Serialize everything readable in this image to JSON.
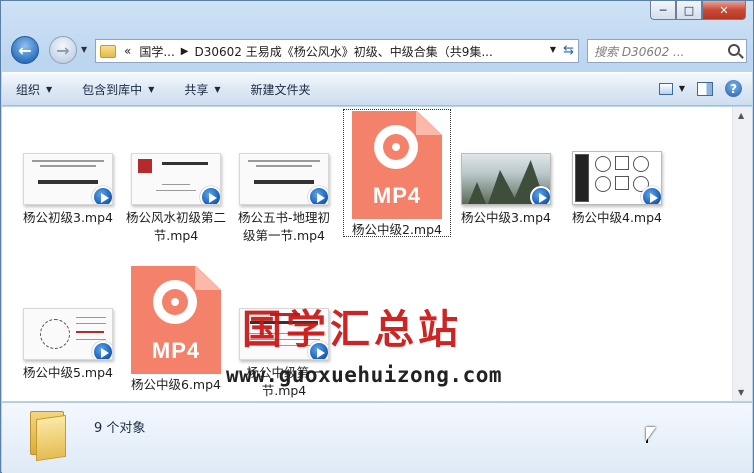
{
  "window": {
    "caption_buttons": [
      "─",
      "□",
      "✕"
    ]
  },
  "address": {
    "prefix": "«",
    "crumbs": [
      "国学...",
      "D30602 王易成《杨公风水》初级、中级合集（共9集..."
    ],
    "search_placeholder": "搜索 D30602 ..."
  },
  "toolbar": {
    "organize": "组织",
    "include_library": "包含到库中",
    "share": "共享",
    "new_folder": "新建文件夹"
  },
  "files": [
    {
      "name": "杨公初级3.mp4",
      "thumb": "slide"
    },
    {
      "name": "杨公风水初级第二节.mp4",
      "thumb": "slide"
    },
    {
      "name": "杨公五书-地理初级第一节.mp4",
      "thumb": "slide"
    },
    {
      "name": "杨公中级2.mp4",
      "thumb": "mp4-icon"
    },
    {
      "name": "杨公中级3.mp4",
      "thumb": "mountain"
    },
    {
      "name": "杨公中级4.mp4",
      "thumb": "diagram"
    },
    {
      "name": "杨公中级5.mp4",
      "thumb": "slide"
    },
    {
      "name": "杨公中级6.mp4",
      "thumb": "mp4-icon"
    },
    {
      "name": "杨公中级第一节.mp4",
      "thumb": "slide"
    }
  ],
  "mp4_label": "MP4",
  "watermark": {
    "title": "国学汇总站",
    "url": "www.guoxuehuizong.com"
  },
  "details": {
    "count": "9 个对象"
  },
  "colors": {
    "mp4_orange": "#f4826a",
    "watermark_red": "#cc1212",
    "accent_blue": "#1458ad"
  }
}
